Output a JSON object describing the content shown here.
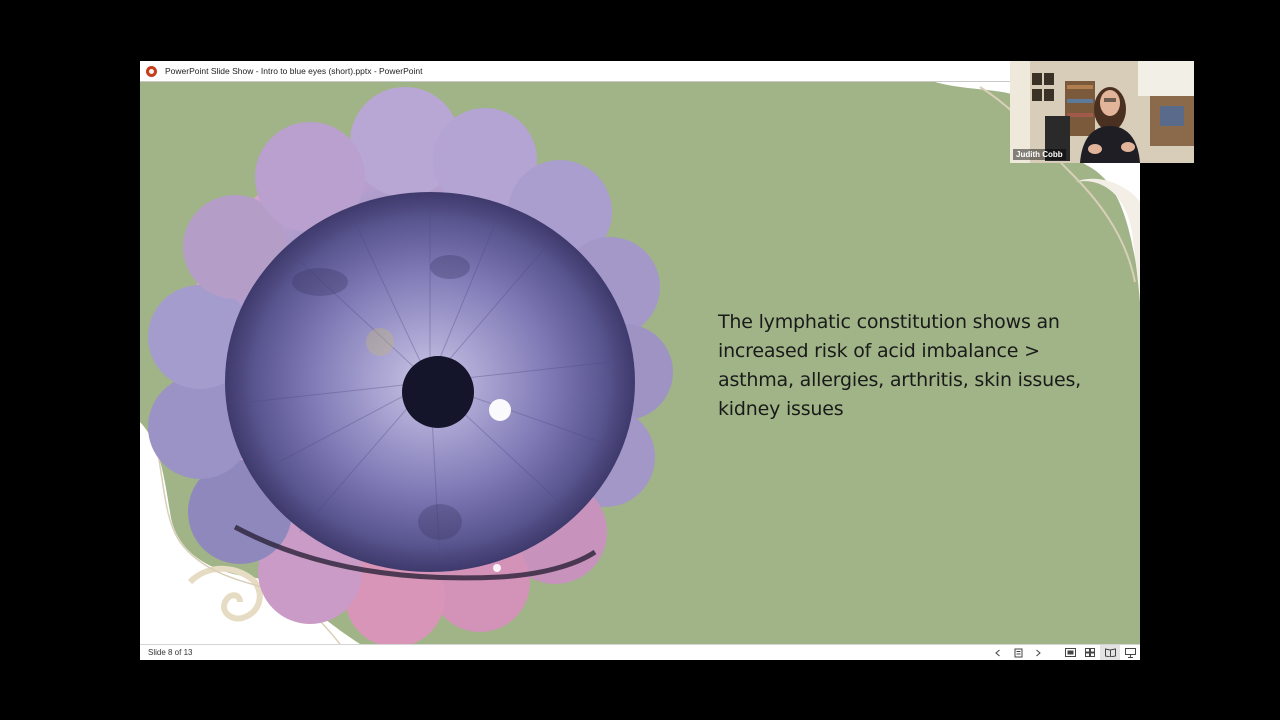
{
  "window": {
    "title": "PowerPoint Slide Show  -  Intro to blue eyes (short).pptx - PowerPoint"
  },
  "slide": {
    "body_text": "The lymphatic constitution shows an increased risk of acid imbalance > asthma, allergies, arthritis, skin issues, kidney issues",
    "background_color": "#a0b487",
    "iris_image": "iris-photo"
  },
  "statusbar": {
    "slide_counter": "Slide 8 of 13",
    "controls": [
      "chevron-left-icon",
      "slide-sorter-icon",
      "chevron-right-icon",
      "normal-view-icon",
      "grid-view-icon",
      "reading-view-icon",
      "slideshow-icon"
    ]
  },
  "video": {
    "participant_name": "Judith Cobb"
  },
  "colors": {
    "accent": "#c43e1c",
    "iris": "#6e6aa6",
    "blossom": "#d08fbf"
  }
}
